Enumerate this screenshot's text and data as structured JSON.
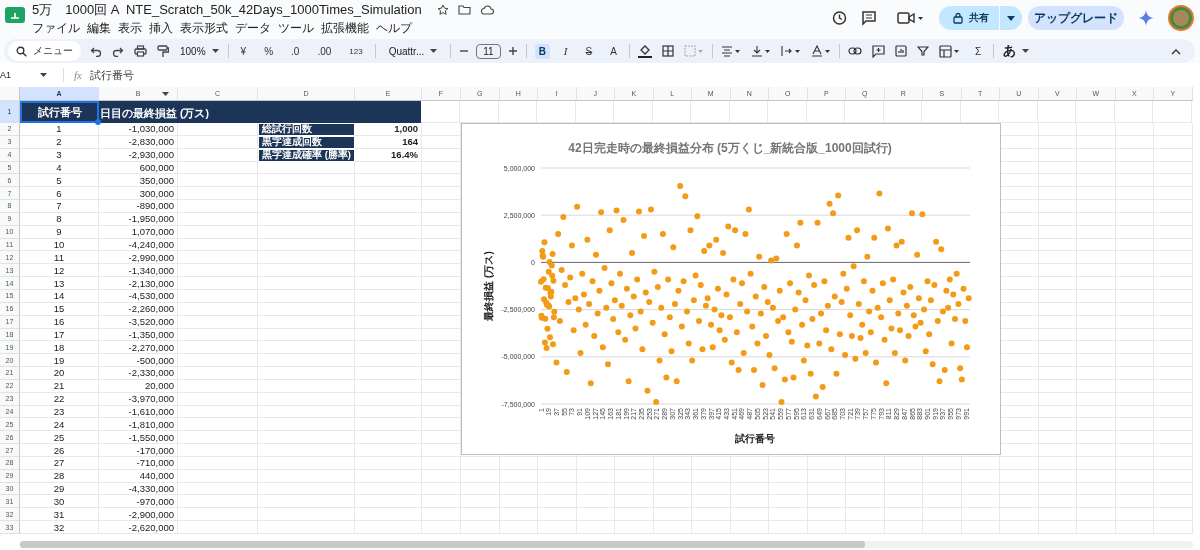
{
  "doc": {
    "title": "5万　1000回 A  NTE_Scratch_50k_42Days_1000Times_Simulation"
  },
  "menu": [
    "ファイル",
    "編集",
    "表示",
    "挿入",
    "表示形式",
    "データ",
    "ツール",
    "拡張機能",
    "ヘルプ"
  ],
  "header_buttons": {
    "share": "共有",
    "upgrade": "アップグレード"
  },
  "toolbar": {
    "search": "メニュー",
    "zoom": "100%",
    "currency": "¥",
    "percent": "%",
    "dec_minus": ".0",
    "dec_plus": ".00",
    "format": "123",
    "font": "Quattr...",
    "font_size": "11",
    "bold": "B",
    "bold_selected": true,
    "italic": "I",
    "strike": "S",
    "text_color": "A",
    "sum": "Σ",
    "ime": "あ"
  },
  "formula_bar": {
    "cell": "A1",
    "fx": "fx",
    "value": "試行番号"
  },
  "columns": [
    {
      "label": "A",
      "selected": true,
      "filter": false
    },
    {
      "label": "B",
      "selected": false,
      "filter": true
    },
    {
      "label": "C",
      "selected": false,
      "filter": false
    },
    {
      "label": "D",
      "selected": false,
      "filter": false
    },
    {
      "label": "E",
      "selected": false,
      "filter": false
    },
    {
      "label": "F",
      "selected": false,
      "filter": false
    },
    {
      "label": "G",
      "selected": false,
      "filter": false
    },
    {
      "label": "H",
      "selected": false,
      "filter": false
    },
    {
      "label": "I",
      "selected": false,
      "filter": false
    },
    {
      "label": "J",
      "selected": false,
      "filter": false
    },
    {
      "label": "K",
      "selected": false,
      "filter": false
    },
    {
      "label": "L",
      "selected": false,
      "filter": false
    },
    {
      "label": "M",
      "selected": false,
      "filter": false
    },
    {
      "label": "N",
      "selected": false,
      "filter": false
    },
    {
      "label": "O",
      "selected": false,
      "filter": false
    },
    {
      "label": "P",
      "selected": false,
      "filter": false
    },
    {
      "label": "Q",
      "selected": false,
      "filter": false
    },
    {
      "label": "R",
      "selected": false,
      "filter": false
    },
    {
      "label": "S",
      "selected": false,
      "filter": false
    },
    {
      "label": "T",
      "selected": false,
      "filter": false
    },
    {
      "label": "U",
      "selected": false,
      "filter": false
    },
    {
      "label": "V",
      "selected": false,
      "filter": false
    },
    {
      "label": "W",
      "selected": false,
      "filter": false
    },
    {
      "label": "X",
      "selected": false,
      "filter": false
    },
    {
      "label": "Y",
      "selected": false,
      "filter": false
    }
  ],
  "header_row": {
    "number": "1",
    "selected": true,
    "a": "試行番号",
    "b": "日目の最終損益 (万ス)"
  },
  "rows": [
    {
      "number": "2",
      "trial": "1",
      "result": "-1,030,000"
    },
    {
      "number": "3",
      "trial": "2",
      "result": "-2,830,000"
    },
    {
      "number": "4",
      "trial": "3",
      "result": "-2,930,000"
    },
    {
      "number": "5",
      "trial": "4",
      "result": "600,000"
    },
    {
      "number": "6",
      "trial": "5",
      "result": "350,000"
    },
    {
      "number": "7",
      "trial": "6",
      "result": "300,000"
    },
    {
      "number": "8",
      "trial": "7",
      "result": "-890,000"
    },
    {
      "number": "9",
      "trial": "8",
      "result": "-1,950,000"
    },
    {
      "number": "10",
      "trial": "9",
      "result": "1,070,000"
    },
    {
      "number": "11",
      "trial": "10",
      "result": "-4,240,000"
    },
    {
      "number": "12",
      "trial": "11",
      "result": "-2,990,000"
    },
    {
      "number": "13",
      "trial": "12",
      "result": "-1,340,000"
    },
    {
      "number": "14",
      "trial": "13",
      "result": "-2,130,000"
    },
    {
      "number": "15",
      "trial": "14",
      "result": "-4,530,000"
    },
    {
      "number": "16",
      "trial": "15",
      "result": "-2,260,000"
    },
    {
      "number": "17",
      "trial": "16",
      "result": "-3,520,000"
    },
    {
      "number": "18",
      "trial": "17",
      "result": "-1,350,000"
    },
    {
      "number": "19",
      "trial": "18",
      "result": "-2,270,000"
    },
    {
      "number": "20",
      "trial": "19",
      "result": "-500,000"
    },
    {
      "number": "21",
      "trial": "20",
      "result": "-2,330,000"
    },
    {
      "number": "22",
      "trial": "21",
      "result": "20,000"
    },
    {
      "number": "23",
      "trial": "22",
      "result": "-3,970,000"
    },
    {
      "number": "24",
      "trial": "23",
      "result": "-1,610,000"
    },
    {
      "number": "25",
      "trial": "24",
      "result": "-1,810,000"
    },
    {
      "number": "26",
      "trial": "25",
      "result": "-1,550,000"
    },
    {
      "number": "27",
      "trial": "26",
      "result": "-170,000"
    },
    {
      "number": "28",
      "trial": "27",
      "result": "-710,000"
    },
    {
      "number": "29",
      "trial": "28",
      "result": "440,000"
    },
    {
      "number": "30",
      "trial": "29",
      "result": "-4,330,000"
    },
    {
      "number": "31",
      "trial": "30",
      "result": "-970,000"
    },
    {
      "number": "32",
      "trial": "31",
      "result": "-2,900,000"
    },
    {
      "number": "33",
      "trial": "32",
      "result": "-2,620,000"
    }
  ],
  "summary": [
    {
      "label": "総試行回数",
      "value": "1,000"
    },
    {
      "label": "黒字達成回数",
      "value": "164"
    },
    {
      "label": "黒字達成確率 (勝率)",
      "value": "16.4%"
    }
  ],
  "chart": {
    "chart_data": {
      "type": "scatter",
      "title": "42日完走時の最終損益分布 (5万くじ_新統合版_1000回試行)",
      "xlabel": "試行番号",
      "ylabel": "最終損益 (万ス)",
      "xlim": [
        1,
        1000
      ],
      "ylim": [
        -7500000,
        5000000
      ],
      "yticks": [
        {
          "value": 5000000,
          "label": "5,000,000"
        },
        {
          "value": 2500000,
          "label": "2,500,000"
        },
        {
          "value": 0,
          "label": "0"
        },
        {
          "value": -2500000,
          "label": "-2,500,000"
        },
        {
          "value": -5000000,
          "label": "-5,000,000"
        },
        {
          "value": -7500000,
          "label": "-7,500,000"
        }
      ],
      "xticks": [
        1,
        19,
        37,
        55,
        73,
        91,
        109,
        127,
        145,
        163,
        181,
        199,
        217,
        235,
        253,
        271,
        289,
        307,
        325,
        343,
        361,
        379,
        397,
        415,
        433,
        451,
        469,
        487,
        505,
        523,
        541,
        559,
        577,
        595,
        613,
        631,
        649,
        667,
        685,
        703,
        721,
        739,
        757,
        775,
        793,
        811,
        829,
        847,
        865,
        883,
        901,
        919,
        937,
        955,
        973,
        991
      ],
      "grid": true,
      "series": [
        {
          "color": "#f39a17",
          "x": [
            1,
            2,
            3,
            4,
            5,
            6,
            7,
            8,
            9,
            10,
            11,
            12,
            13,
            14,
            15,
            16,
            17,
            18,
            19,
            20,
            21,
            22,
            23,
            24,
            25,
            26,
            27,
            28,
            29,
            30,
            31,
            32,
            37,
            41,
            45,
            49,
            53,
            57,
            61,
            65,
            69,
            73,
            77,
            81,
            85,
            89,
            93,
            97,
            101,
            105,
            109,
            113,
            117,
            121,
            125,
            129,
            133,
            137,
            141,
            145,
            149,
            153,
            157,
            161,
            165,
            169,
            173,
            177,
            181,
            185,
            189,
            193,
            197,
            201,
            205,
            209,
            213,
            217,
            221,
            225,
            229,
            233,
            237,
            241,
            245,
            249,
            253,
            257,
            261,
            265,
            269,
            273,
            277,
            281,
            285,
            289,
            293,
            297,
            301,
            305,
            309,
            313,
            317,
            321,
            325,
            329,
            333,
            337,
            341,
            345,
            349,
            353,
            357,
            361,
            365,
            369,
            373,
            377,
            381,
            385,
            389,
            393,
            397,
            401,
            405,
            409,
            413,
            417,
            421,
            425,
            429,
            433,
            437,
            441,
            445,
            449,
            453,
            457,
            461,
            465,
            469,
            473,
            477,
            481,
            485,
            489,
            493,
            497,
            501,
            505,
            509,
            513,
            517,
            521,
            525,
            529,
            533,
            537,
            541,
            545,
            549,
            553,
            557,
            561,
            565,
            569,
            573,
            577,
            581,
            585,
            589,
            593,
            597,
            601,
            605,
            609,
            613,
            617,
            621,
            625,
            629,
            633,
            637,
            641,
            645,
            649,
            653,
            657,
            661,
            665,
            669,
            673,
            677,
            681,
            685,
            689,
            693,
            697,
            701,
            705,
            709,
            713,
            717,
            721,
            725,
            729,
            733,
            737,
            741,
            745,
            749,
            753,
            757,
            761,
            765,
            769,
            773,
            777,
            781,
            785,
            789,
            793,
            797,
            801,
            805,
            809,
            813,
            817,
            821,
            825,
            829,
            833,
            837,
            841,
            845,
            849,
            853,
            857,
            861,
            865,
            869,
            873,
            877,
            881,
            885,
            889,
            893,
            897,
            901,
            905,
            909,
            913,
            917,
            921,
            925,
            929,
            933,
            937,
            941,
            945,
            949,
            953,
            957,
            961,
            965,
            969,
            973,
            977,
            981,
            985,
            989,
            993,
            997
          ],
          "values": [
            -1030000,
            -2830000,
            -2930000,
            600000,
            350000,
            300000,
            -890000,
            -1950000,
            1070000,
            -4240000,
            -2990000,
            -1340000,
            -2130000,
            -4530000,
            -2260000,
            -3520000,
            -1350000,
            -2270000,
            -500000,
            -2330000,
            20000,
            -3970000,
            -1610000,
            -1810000,
            -1550000,
            -170000,
            -710000,
            440000,
            -4330000,
            -970000,
            -2900000,
            -2620000,
            -5300000,
            1500000,
            -3100000,
            -400000,
            2400000,
            -1200000,
            -5800000,
            -2100000,
            -800000,
            900000,
            -3600000,
            -1900000,
            2950000,
            -2500000,
            -4800000,
            -600000,
            -1700000,
            -3300000,
            1200000,
            -2200000,
            -6400000,
            -1000000,
            -3900000,
            400000,
            -2700000,
            -1500000,
            2650000,
            -4500000,
            -300000,
            -2400000,
            -5400000,
            1700000,
            -1100000,
            -3000000,
            -2000000,
            2750000,
            -3700000,
            -600000,
            -2300000,
            2250000,
            -4100000,
            -1400000,
            -6300000,
            -2800000,
            500000,
            -1800000,
            -3500000,
            -900000,
            2700000,
            -2600000,
            -4600000,
            1400000,
            -1600000,
            -6800000,
            -2100000,
            2800000,
            -3200000,
            -500000,
            -7400000,
            -1300000,
            -5200000,
            -2400000,
            1500000,
            -3800000,
            -6100000,
            -900000,
            -2900000,
            -4700000,
            800000,
            -2200000,
            -6300000,
            -1500000,
            4050000,
            -3400000,
            -1000000,
            3500000,
            -2600000,
            -4300000,
            1700000,
            -5200000,
            -2000000,
            -700000,
            2450000,
            -3100000,
            -1200000,
            -4600000,
            600000,
            -2300000,
            -1900000,
            900000,
            -3300000,
            -4500000,
            -2500000,
            1200000,
            -1400000,
            -3600000,
            -2800000,
            500000,
            -4100000,
            -1700000,
            1900000,
            -2900000,
            -5300000,
            -900000,
            1700000,
            -3700000,
            -5700000,
            -2200000,
            -1100000,
            -4800000,
            1500000,
            -2600000,
            2800000,
            -600000,
            -3400000,
            -5700000,
            -1800000,
            -4300000,
            300000,
            -2700000,
            -6500000,
            -1300000,
            -3900000,
            -2100000,
            -4900000,
            100000,
            -2400000,
            -5600000,
            200000,
            -3100000,
            -1500000,
            -7400000,
            -2900000,
            -6200000,
            1500000,
            -3700000,
            -1100000,
            -4200000,
            -6100000,
            -2500000,
            900000,
            -1600000,
            2100000,
            -3300000,
            -5200000,
            -2000000,
            -4400000,
            -700000,
            -5900000,
            -3000000,
            -1200000,
            -7100000,
            2100000,
            -4300000,
            -2700000,
            -6600000,
            -1000000,
            -3600000,
            -2300000,
            3100000,
            -4600000,
            2600000,
            -1800000,
            -5900000,
            3550000,
            -3800000,
            -2100000,
            -600000,
            -4900000,
            -1400000,
            1300000,
            -2800000,
            -3900000,
            -200000,
            -5100000,
            1700000,
            -2200000,
            -4000000,
            -3300000,
            -1000000,
            -4800000,
            300000,
            -2600000,
            -3700000,
            -1500000,
            1300000,
            -5300000,
            -2400000,
            3650000,
            -2900000,
            -1100000,
            -4100000,
            -6400000,
            1800000,
            -2000000,
            -3500000,
            -900000,
            -4800000,
            900000,
            -2700000,
            -3600000,
            1100000,
            -1600000,
            -5200000,
            -2300000,
            -3900000,
            -1300000,
            2600000,
            -2800000,
            -3400000,
            400000,
            -1900000,
            -3200000,
            2550000,
            -2500000,
            -4700000,
            -1000000,
            -3800000,
            -2000000,
            -5400000,
            -1200000,
            1100000,
            -3100000,
            -6300000,
            700000,
            -2600000,
            -5700000,
            -1500000,
            -2400000,
            -900000,
            -4300000,
            -1700000,
            -3000000,
            -600000,
            -2200000,
            -5600000,
            -6200000,
            -1400000,
            -3100000,
            -4500000,
            -1900000
          ]
        }
      ]
    }
  }
}
